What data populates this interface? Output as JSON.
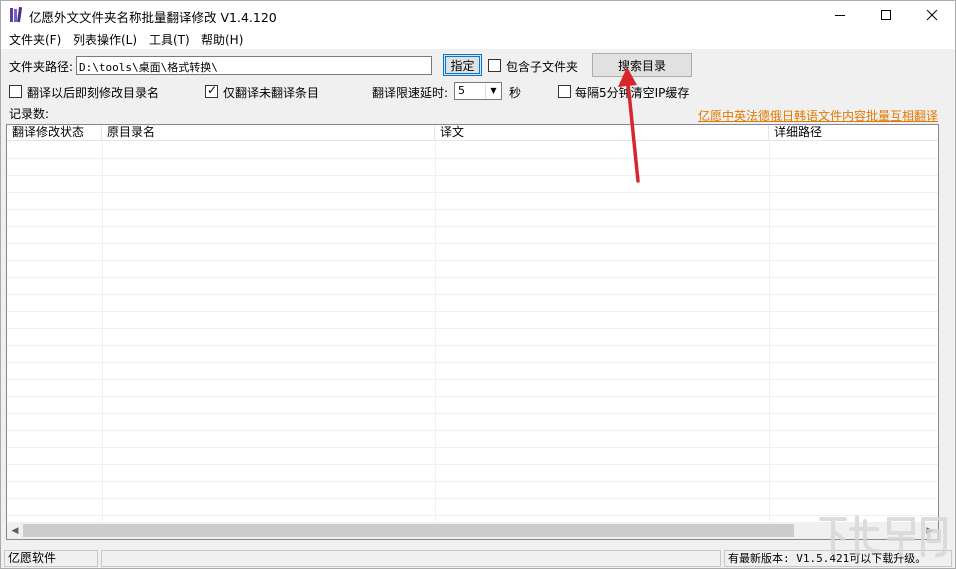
{
  "window": {
    "title": "亿愿外文文件夹名称批量翻译修改 V1.4.120",
    "controls": [
      "minimize-icon",
      "maximize-icon",
      "close-icon"
    ]
  },
  "menu": {
    "items": [
      {
        "label": "文件夹(F)"
      },
      {
        "label": "列表操作(L)"
      },
      {
        "label": "工具(T)"
      },
      {
        "label": "帮助(H)"
      }
    ]
  },
  "path": {
    "label": "文件夹路径:",
    "value": "D:\\tools\\桌面\\格式转换\\"
  },
  "buttons": {
    "assign": "指定",
    "search": "搜索目录"
  },
  "options": {
    "include_subfolders": {
      "label": "包含子文件夹",
      "checked": false
    },
    "rename_after_translate": {
      "label": "翻译以后即刻修改目录名",
      "checked": false
    },
    "only_untranslated": {
      "label": "仅翻译未翻译条目",
      "checked": true
    },
    "delay_label": "翻译限速延时:",
    "delay_value": "5",
    "delay_unit": "秒",
    "clear_ip_cache": {
      "label": "每隔5分钟清空IP缓存",
      "checked": false
    }
  },
  "records_label": "记录数:",
  "promo_link": "亿愿中英法德俄日韩语文件内容批量互相翻译",
  "table": {
    "columns": [
      "翻译修改状态",
      "原目录名",
      "译文",
      "详细路径"
    ],
    "rows": []
  },
  "status": {
    "left": "亿愿软件",
    "middle": "",
    "right": "有最新版本: V1.5.421可以下载升级。"
  },
  "watermark_text": "下载吧",
  "colors": {
    "link": "#e07a00",
    "annotation_arrow": "#d9262c",
    "focus_border": "#0078d7"
  }
}
